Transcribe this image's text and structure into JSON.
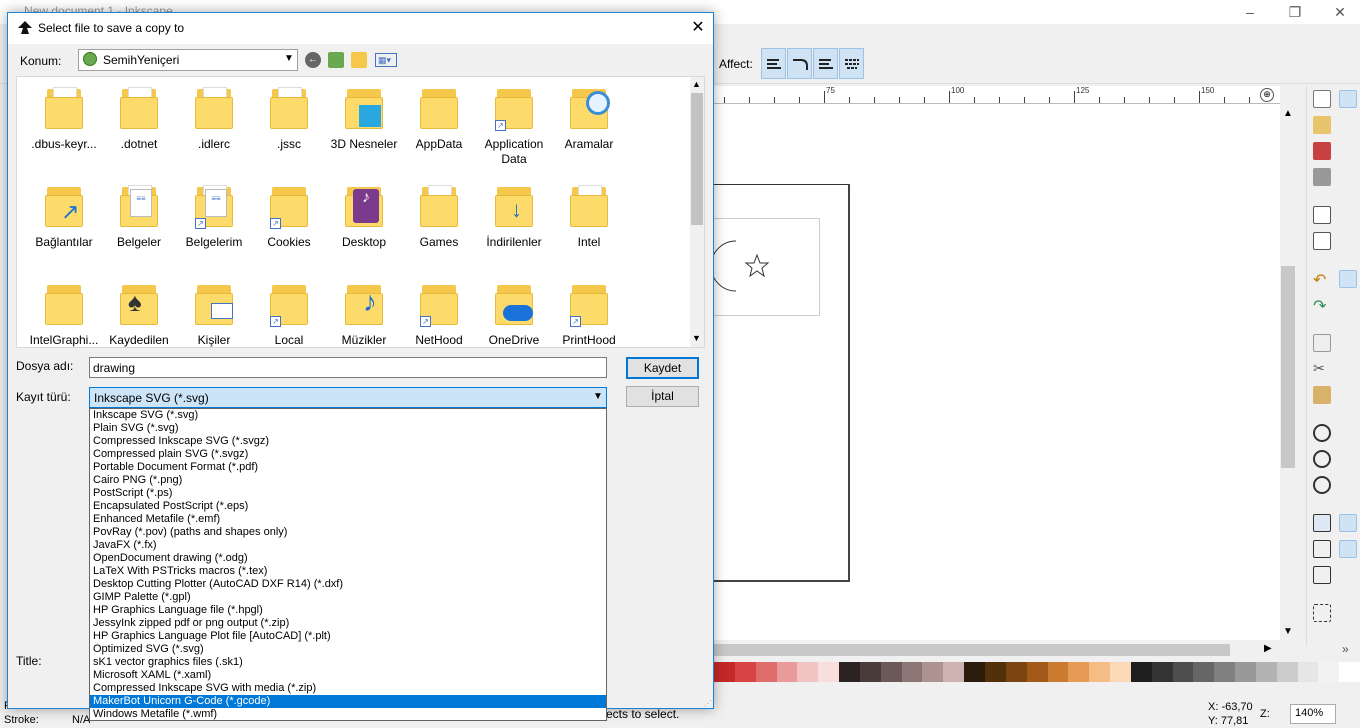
{
  "inkscape": {
    "window_title": "New document 1 - Inkscape",
    "affect_label": "Affect:",
    "ruler_labels": [
      "75",
      "100",
      "125",
      "150"
    ],
    "status_message": "ects to select.",
    "fill_label": "Fill:",
    "stroke_label": "Stroke:",
    "stroke_value": "N/A",
    "coords": {
      "x_label": "X:",
      "x_value": "-63,70",
      "y_label": "Y:",
      "y_value": "77,81"
    },
    "zoom_label": "Z:",
    "zoom_value": "140%",
    "palette": [
      "#c62828",
      "#d84343",
      "#e06b6b",
      "#e99a9a",
      "#f2c4c4",
      "#f8dede",
      "#2b2222",
      "#4a3b3b",
      "#6b5858",
      "#8c7575",
      "#ad9292",
      "#cfb3b3",
      "#2b1b0b",
      "#52300a",
      "#7a4510",
      "#a35a18",
      "#cc7a30",
      "#e69a55",
      "#f5bd85",
      "#fcdab8",
      "#1e1e1e",
      "#333333",
      "#4d4d4d",
      "#666666",
      "#808080",
      "#999999",
      "#b3b3b3",
      "#cccccc",
      "#e6e6e6",
      "#f2f2f2",
      "#ffffff"
    ]
  },
  "dialog": {
    "title": "Select file to save a copy to",
    "close_glyph": "✕",
    "location_label": "Konum:",
    "location_value": "SemihYeniçeri",
    "files": [
      {
        "name": ".dbus-keyr...",
        "kind": "paper",
        "shortcut": false
      },
      {
        "name": ".dotnet",
        "kind": "paper",
        "shortcut": false
      },
      {
        "name": ".idlerc",
        "kind": "paper",
        "shortcut": false
      },
      {
        "name": ".jssc",
        "kind": "paper",
        "shortcut": false
      },
      {
        "name": "3D Nesneler",
        "kind": "3d",
        "shortcut": false
      },
      {
        "name": "AppData",
        "kind": "plain",
        "shortcut": false
      },
      {
        "name": "Application Data",
        "kind": "plain",
        "shortcut": true
      },
      {
        "name": "Aramalar",
        "kind": "search",
        "shortcut": false
      },
      {
        "name": "Bağlantılar",
        "kind": "link",
        "shortcut": false
      },
      {
        "name": "Belgeler",
        "kind": "doc",
        "shortcut": false
      },
      {
        "name": "Belgelerim",
        "kind": "doc",
        "shortcut": true
      },
      {
        "name": "Cookies",
        "kind": "plain",
        "shortcut": true
      },
      {
        "name": "Desktop",
        "kind": "desktop",
        "shortcut": false
      },
      {
        "name": "Games",
        "kind": "paper",
        "shortcut": false
      },
      {
        "name": "İndirilenler",
        "kind": "download",
        "shortcut": false
      },
      {
        "name": "Intel",
        "kind": "paper",
        "shortcut": false
      },
      {
        "name": "IntelGraphi...",
        "kind": "plain",
        "shortcut": false
      },
      {
        "name": "Kaydedilen",
        "kind": "games",
        "shortcut": false
      },
      {
        "name": "Kişiler",
        "kind": "contacts",
        "shortcut": false
      },
      {
        "name": "Local",
        "kind": "plain",
        "shortcut": true
      },
      {
        "name": "Müzikler",
        "kind": "music",
        "shortcut": false
      },
      {
        "name": "NetHood",
        "kind": "plain",
        "shortcut": true
      },
      {
        "name": "OneDrive",
        "kind": "cloud",
        "shortcut": false
      },
      {
        "name": "PrintHood",
        "kind": "plain",
        "shortcut": true
      }
    ],
    "filename_label": "Dosya adı:",
    "filename_value": "drawing",
    "filetype_label": "Kayıt türü:",
    "filetype_value": "Inkscape SVG (*.svg)",
    "save_label": "Kaydet",
    "cancel_label": "İptal",
    "title_label": "Title:",
    "filetype_options": [
      "Inkscape SVG (*.svg)",
      "Plain SVG (*.svg)",
      "Compressed Inkscape SVG (*.svgz)",
      "Compressed plain SVG (*.svgz)",
      "Portable Document Format (*.pdf)",
      "Cairo PNG (*.png)",
      "PostScript (*.ps)",
      "Encapsulated PostScript (*.eps)",
      "Enhanced Metafile (*.emf)",
      "PovRay (*.pov) (paths and shapes only)",
      "JavaFX (*.fx)",
      "OpenDocument drawing (*.odg)",
      "LaTeX With PSTricks macros (*.tex)",
      "Desktop Cutting Plotter (AutoCAD DXF R14) (*.dxf)",
      "GIMP Palette (*.gpl)",
      "HP Graphics Language file (*.hpgl)",
      "JessyInk zipped pdf or png output (*.zip)",
      "HP Graphics Language Plot file [AutoCAD] (*.plt)",
      "Optimized SVG (*.svg)",
      "sK1 vector graphics files (.sk1)",
      "Microsoft XAML (*.xaml)",
      "Compressed Inkscape SVG with media (*.zip)",
      "MakerBot Unicorn G-Code (*.gcode)",
      "Windows Metafile (*.wmf)"
    ],
    "selected_option_index": 22
  }
}
